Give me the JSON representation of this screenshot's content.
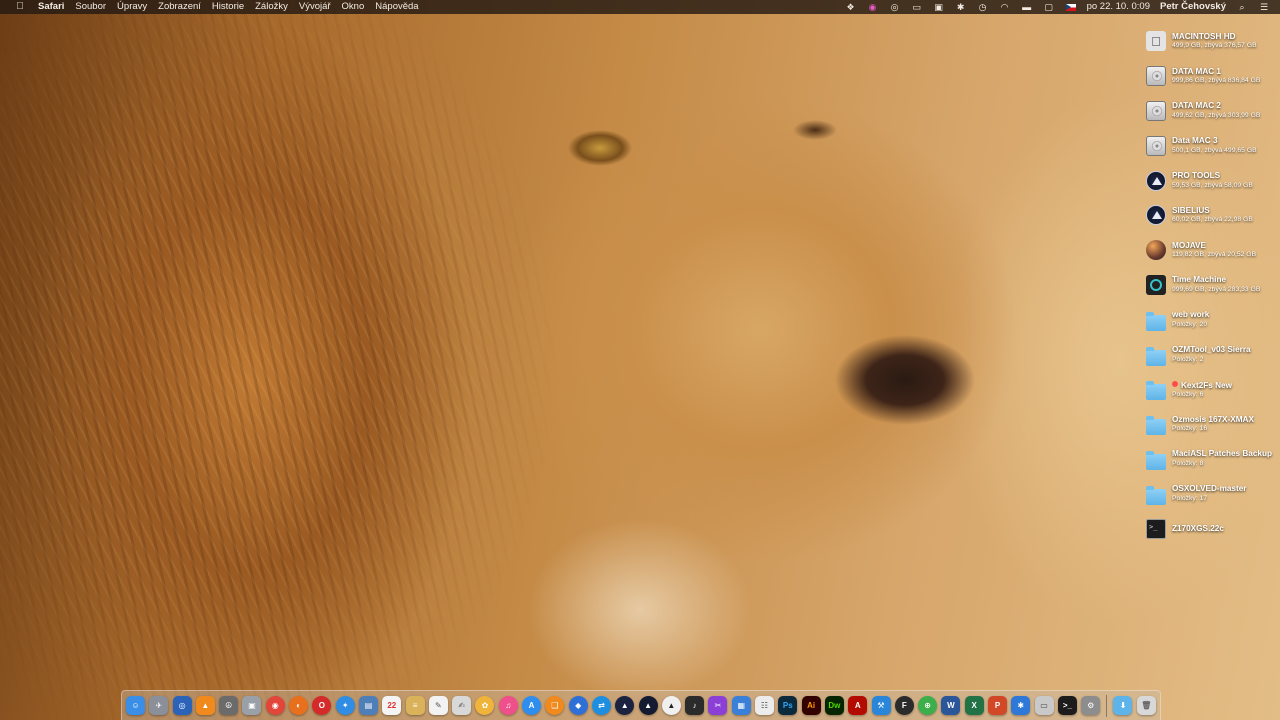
{
  "menubar": {
    "app_name": "Safari",
    "menus": [
      "Soubor",
      "Úpravy",
      "Zobrazení",
      "Historie",
      "Záložky",
      "Vývojář",
      "Okno",
      "Nápověda"
    ],
    "clock": "po 22. 10.  0:09",
    "user": "Petr Čehovský",
    "status_icons": [
      "dropbox-icon",
      "creative-cloud-icon",
      "eye-icon",
      "monitor-icon",
      "hardware-monitor-icon",
      "bluetooth-icon",
      "time-machine-icon",
      "wifi-icon",
      "battery-icon",
      "airplay-icon",
      "czech-flag-icon",
      "spotlight-search-icon",
      "notification-center-icon"
    ]
  },
  "desktop": {
    "items": [
      {
        "name": "MACINTOSH HD",
        "info": "499,9 GB, zbývá 376,57 GB",
        "icon": "apple-disk-icon"
      },
      {
        "name": "DATA MAC 1",
        "info": "999,86 GB, zbývá 836,84 GB",
        "icon": "hard-disk-icon"
      },
      {
        "name": "DATA MAC 2",
        "info": "499,62 GB, zbývá 303,99 GB",
        "icon": "hard-disk-icon"
      },
      {
        "name": "Data MAC 3",
        "info": "500,1 GB, zbývá 499,65 GB",
        "icon": "hard-disk-icon"
      },
      {
        "name": "PRO TOOLS",
        "info": "59,53 GB, zbývá 58,09 GB",
        "icon": "pro-tools-disk-icon"
      },
      {
        "name": "SIBELIUS",
        "info": "60,02 GB, zbývá 22,98 GB",
        "icon": "pro-tools-disk-icon"
      },
      {
        "name": "MOJAVE",
        "info": "119,82 GB, zbývá 20,52 GB",
        "icon": "mojave-disk-icon"
      },
      {
        "name": "Time Machine",
        "info": "999,69 GB, zbývá 283,33 GB",
        "icon": "time-machine-disk-icon"
      },
      {
        "name": "web work",
        "info": "Položky: 20",
        "icon": "folder-icon"
      },
      {
        "name": "OZMTool_v03 Sierra",
        "info": "Položky: 2",
        "icon": "folder-icon"
      },
      {
        "name": "Kext2Fs New",
        "info": "Položky: 6",
        "icon": "folder-icon",
        "tag": "red"
      },
      {
        "name": "Ozmosis 167X-XMAX",
        "info": "Položky: 16",
        "icon": "folder-icon"
      },
      {
        "name": "MaciASL Patches Backup",
        "info": "Položky: 8",
        "icon": "folder-icon"
      },
      {
        "name": "OSXOLVED-master",
        "info": "Položky: 17",
        "icon": "folder-icon"
      },
      {
        "name": "Z170XGS.22c",
        "info": "",
        "icon": "terminal-file-icon"
      }
    ]
  },
  "dock": {
    "apps": [
      {
        "name": "finder",
        "color": "#3a8ee6",
        "glyph": "☺"
      },
      {
        "name": "launchpad",
        "color": "#8a8f99",
        "glyph": "✈"
      },
      {
        "name": "safari-blue",
        "color": "#2a63b8",
        "glyph": "◎"
      },
      {
        "name": "vlc",
        "color": "#f08a1c",
        "glyph": "▲"
      },
      {
        "name": "pacifist",
        "color": "#6b6b6b",
        "glyph": "☮"
      },
      {
        "name": "disk-utility",
        "color": "#9aa0a8",
        "glyph": "▣"
      },
      {
        "name": "chrome",
        "color": "#e2453a",
        "glyph": "◉",
        "round": true
      },
      {
        "name": "firefox",
        "color": "#e8701c",
        "glyph": "◐",
        "round": true
      },
      {
        "name": "opera",
        "color": "#d42a2a",
        "glyph": "O",
        "round": true
      },
      {
        "name": "safari",
        "color": "#2f8de4",
        "glyph": "✦",
        "round": true
      },
      {
        "name": "preview",
        "color": "#4f7fb8",
        "glyph": "▤"
      },
      {
        "name": "calendar",
        "color": "#f4f4f4",
        "glyph": "22",
        "text_color": "#d33"
      },
      {
        "name": "notes",
        "color": "#d9b25a",
        "glyph": "≡"
      },
      {
        "name": "textedit",
        "color": "#f2f2f2",
        "glyph": "✎",
        "text_color": "#555"
      },
      {
        "name": "script-editor",
        "color": "#d8d8d8",
        "glyph": "✍",
        "text_color": "#555"
      },
      {
        "name": "photos",
        "color": "#f0b43a",
        "glyph": "✿",
        "round": true
      },
      {
        "name": "itunes",
        "color": "#ef4f8b",
        "glyph": "♫",
        "round": true
      },
      {
        "name": "app-store",
        "color": "#2d8ef0",
        "glyph": "A",
        "round": true
      },
      {
        "name": "books",
        "color": "#f08a1c",
        "glyph": "❑",
        "round": true
      },
      {
        "name": "system-utility",
        "color": "#2e6fd8",
        "glyph": "◆",
        "round": true
      },
      {
        "name": "teamviewer",
        "color": "#1e8fe0",
        "glyph": "⇄",
        "round": true
      },
      {
        "name": "pro-tools",
        "color": "#1b2340",
        "glyph": "▲",
        "round": true
      },
      {
        "name": "sibelius",
        "color": "#141a30",
        "glyph": "▲",
        "round": true
      },
      {
        "name": "avid-app",
        "color": "#f0f0f0",
        "glyph": "▲",
        "round": true,
        "text_color": "#222"
      },
      {
        "name": "music-player",
        "color": "#2b2b2b",
        "glyph": "♪"
      },
      {
        "name": "final-cut-pro",
        "color": "#8c3fd6",
        "glyph": "✂"
      },
      {
        "name": "image-capture",
        "color": "#3a7fd8",
        "glyph": "▦"
      },
      {
        "name": "document",
        "color": "#ececec",
        "glyph": "☷",
        "text_color": "#555"
      },
      {
        "name": "photoshop",
        "color": "#0b2a3b",
        "glyph": "Ps",
        "text_color": "#31a8ff"
      },
      {
        "name": "illustrator",
        "color": "#330000",
        "glyph": "Ai",
        "text_color": "#ff9a00"
      },
      {
        "name": "dreamweaver",
        "color": "#072401",
        "glyph": "Dw",
        "text_color": "#4cd900"
      },
      {
        "name": "acrobat",
        "color": "#b30b00",
        "glyph": "A"
      },
      {
        "name": "xcode",
        "color": "#2a86d8",
        "glyph": "⚒"
      },
      {
        "name": "fontexplorer",
        "color": "#2b2b2b",
        "glyph": "F",
        "round": true
      },
      {
        "name": "cleaner",
        "color": "#3cae4a",
        "glyph": "⊕",
        "round": true
      },
      {
        "name": "word",
        "color": "#2b579a",
        "glyph": "W"
      },
      {
        "name": "excel",
        "color": "#217346",
        "glyph": "X"
      },
      {
        "name": "powerpoint",
        "color": "#d24726",
        "glyph": "P"
      },
      {
        "name": "bluetooth-utility",
        "color": "#2e78d8",
        "glyph": "✱"
      },
      {
        "name": "hard-drive-utility",
        "color": "#c9c9c9",
        "glyph": "▭",
        "text_color": "#444"
      },
      {
        "name": "terminal",
        "color": "#1c1c1c",
        "glyph": ">_"
      },
      {
        "name": "system-preferences",
        "color": "#8d8d8d",
        "glyph": "⚙"
      }
    ],
    "tray": [
      {
        "name": "downloads-folder",
        "color": "#5eb4e8",
        "glyph": "⬇"
      },
      {
        "name": "trash",
        "color": "#d8d8d8",
        "glyph": "🗑",
        "text_color": "#666"
      }
    ]
  }
}
